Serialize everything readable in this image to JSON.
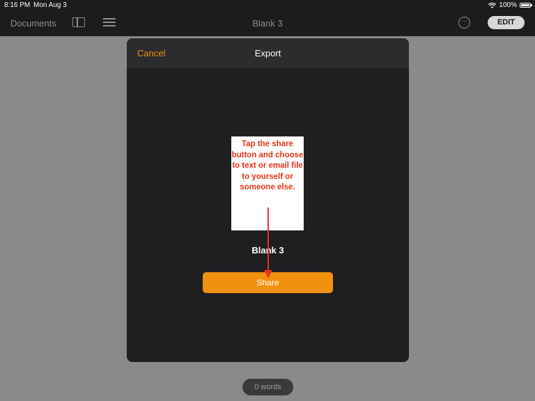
{
  "status_bar": {
    "time": "8:16 PM",
    "date": "Mon Aug 3",
    "battery": "100%",
    "wifi_icon": "wifi-icon",
    "battery_icon": "battery-icon"
  },
  "toolbar": {
    "documents_label": "Documents",
    "sidebar_icon": "sidebar-icon",
    "list_icon": "list-icon",
    "title": "Blank 3",
    "more_icon": "ellipsis-circle-icon",
    "edit_label": "EDIT"
  },
  "modal": {
    "cancel_label": "Cancel",
    "title": "Export",
    "annotation_text": "Tap the share button and choose to text or email file to yourself or someone else.",
    "file_name": "Blank 3",
    "share_label": "Share"
  },
  "document": {
    "word_count": "0 words"
  },
  "colors": {
    "accent": "#f0910f",
    "annotation": "#e8351c",
    "modal_bg": "#1f1f21"
  }
}
